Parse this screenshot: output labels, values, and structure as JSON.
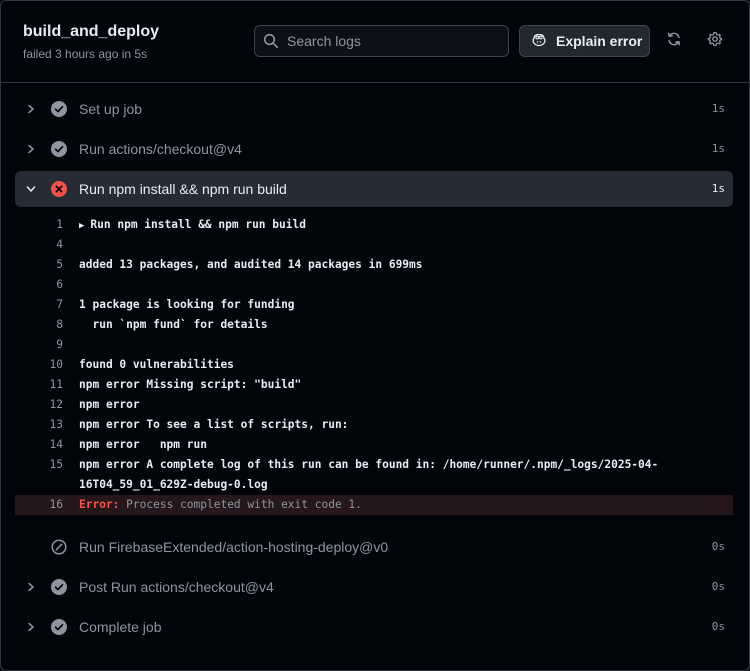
{
  "header": {
    "title": "build_and_deploy",
    "meta": "failed 3 hours ago in 5s",
    "search_placeholder": "Search logs",
    "explain_label": "Explain error"
  },
  "colors": {
    "success": "#8d96a0",
    "failure": "#f85149",
    "skipped": "#8d96a0",
    "active_bg": "#262c36"
  },
  "steps_before": [
    {
      "name": "Set up job",
      "duration": "1s",
      "status": "success",
      "icon": "check-circle-icon"
    },
    {
      "name": "Run actions/checkout@v4",
      "duration": "1s",
      "status": "success",
      "icon": "check-circle-icon"
    }
  ],
  "active_step": {
    "name": "Run npm install && npm run build",
    "duration": "1s",
    "status": "failure",
    "icon": "x-circle-icon"
  },
  "log": [
    {
      "num": "1",
      "text": "Run npm install && npm run build",
      "group": true
    },
    {
      "num": "4",
      "text": ""
    },
    {
      "num": "5",
      "text": "added 13 packages, and audited 14 packages in 699ms"
    },
    {
      "num": "6",
      "text": ""
    },
    {
      "num": "7",
      "text": "1 package is looking for funding"
    },
    {
      "num": "8",
      "text": "  run `npm fund` for details"
    },
    {
      "num": "9",
      "text": ""
    },
    {
      "num": "10",
      "text": "found 0 vulnerabilities"
    },
    {
      "num": "11",
      "text": "npm error Missing script: \"build\""
    },
    {
      "num": "12",
      "text": "npm error"
    },
    {
      "num": "13",
      "text": "npm error To see a list of scripts, run:"
    },
    {
      "num": "14",
      "text": "npm error   npm run"
    },
    {
      "num": "15",
      "text": "npm error A complete log of this run can be found in: /home/runner/.npm/_logs/2025-04-"
    },
    {
      "num": "",
      "text": "16T04_59_01_629Z-debug-0.log"
    }
  ],
  "error_line": {
    "num": "16",
    "label": "Error:",
    "text": " Process completed with exit code 1."
  },
  "steps_after": [
    {
      "name": "Run FirebaseExtended/action-hosting-deploy@v0",
      "duration": "0s",
      "status": "skipped",
      "icon": "skipped-icon",
      "expandable": false
    },
    {
      "name": "Post Run actions/checkout@v4",
      "duration": "0s",
      "status": "success",
      "icon": "check-circle-icon",
      "expandable": true
    },
    {
      "name": "Complete job",
      "duration": "0s",
      "status": "success",
      "icon": "check-circle-icon",
      "expandable": true
    }
  ]
}
